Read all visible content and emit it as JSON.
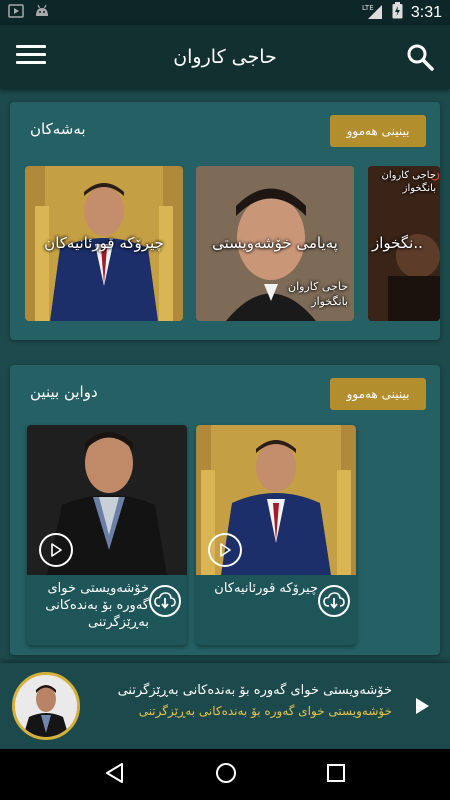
{
  "status_bar": {
    "time": "3:31",
    "network": "LTE",
    "icons": [
      "gallery-icon",
      "android-icon",
      "signal-icon",
      "battery-icon"
    ]
  },
  "app_bar": {
    "title": "حاجی کاروان",
    "menu_icon": "hamburger-menu-icon",
    "search_icon": "search-icon"
  },
  "sections": {
    "categories": {
      "title": "بەشەکان",
      "see_all": "بینینی هەموو",
      "items": [
        {
          "label": "چیرۆکە قورئانیەکان"
        },
        {
          "label": "پەیامی خۆشەویستی",
          "poster_text": "حاجی کاروان\nبانگخواز"
        },
        {
          "label": "نگخواز..",
          "poster_text": "حاجی کاروان\nبانگخواز"
        }
      ]
    },
    "latest": {
      "title": "دواین بینین",
      "see_all": "بینینی هەموو",
      "items": [
        {
          "title": "خۆشەویستی خوای گەورە بۆ بەندەکانی بەڕێزگرتنی"
        },
        {
          "title": "چیرۆکە قورئانیەکان"
        }
      ]
    }
  },
  "player": {
    "title": "خۆشەویستی خوای گەورە بۆ بەندەکانی بەڕێزگرتنی",
    "subtitle": "خۆشەویستی خوای گەورە بۆ بەندەکانی بەڕێزگرتنی",
    "accent_color": "#e6c24b"
  },
  "colors": {
    "background": "#1d4a4c",
    "app_bar": "#11302f",
    "section": "#246064",
    "button": "#b28e2c"
  }
}
